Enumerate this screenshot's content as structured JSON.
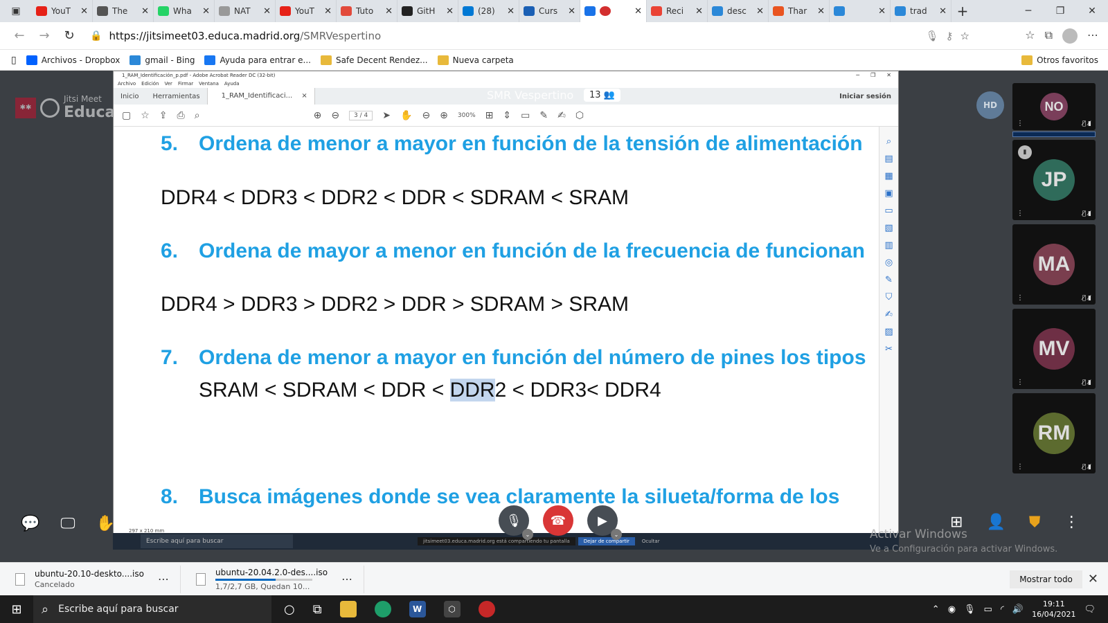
{
  "browser": {
    "tabs": [
      {
        "title": "YouT",
        "fav": "youtube-icon",
        "color": "#e62117"
      },
      {
        "title": "The",
        "fav": "medium-icon",
        "color": "#555555"
      },
      {
        "title": "Wha",
        "fav": "whatsapp-icon",
        "color": "#25d366"
      },
      {
        "title": "NAT",
        "fav": "nat-icon",
        "color": "#999999"
      },
      {
        "title": "YouT",
        "fav": "youtube-icon",
        "color": "#e62117"
      },
      {
        "title": "Tuto",
        "fav": "tuto-icon",
        "color": "#e24a3b"
      },
      {
        "title": "GitH",
        "fav": "github-icon",
        "color": "#222222"
      },
      {
        "title": "(28)",
        "fav": "mail-icon",
        "color": "#0078d4"
      },
      {
        "title": "Curs",
        "fav": "course-icon",
        "color": "#1a5fb4"
      },
      {
        "title": "",
        "fav": "jitsi-icon",
        "color": "#1a73e8",
        "active": true
      },
      {
        "title": "Reci",
        "fav": "gmail-icon",
        "color": "#ea4335"
      },
      {
        "title": "desc",
        "fav": "bing-icon",
        "color": "#2b88d8"
      },
      {
        "title": "Thar",
        "fav": "ubuntu-icon",
        "color": "#e95420"
      },
      {
        "title": "",
        "fav": "bing-icon",
        "color": "#2b88d8"
      },
      {
        "title": "trad",
        "fav": "bing-icon",
        "color": "#2b88d8"
      }
    ],
    "url_host": "https://jitsimeet03.educa.madrid.org",
    "url_path": "/SMRVespertino",
    "bookmarks": [
      {
        "label": "Archivos - Dropbox",
        "color": "#0061fe"
      },
      {
        "label": "gmail - Bing",
        "color": "#2b88d8"
      },
      {
        "label": "Ayuda para entrar e...",
        "color": "#1877f2"
      },
      {
        "label": "Safe Decent Rendez...",
        "color": "#e8b93b"
      },
      {
        "label": "Nueva carpeta",
        "color": "#e8b93b"
      }
    ],
    "other_favorites": "Otros favoritos"
  },
  "jitsi": {
    "brand_small": "Jitsi Meet",
    "brand_large": "Educa",
    "meeting_name": "SMR Vespertino",
    "participant_count": "13",
    "self_initials": "HD",
    "participants": [
      {
        "initials": "NO",
        "color": "#7a3e5a"
      },
      {
        "initials": "JP",
        "color": "#2f6b5a"
      },
      {
        "initials": "MA",
        "color": "#7a3e4e"
      },
      {
        "initials": "MV",
        "color": "#6e2f45"
      },
      {
        "initials": "RM",
        "color": "#5c6b2f"
      }
    ],
    "activate_line1": "Activar Windows",
    "activate_line2": "Ve a Configuración para activar Windows."
  },
  "acrobat": {
    "title": "1_RAM_Identificación_p.pdf - Adobe Acrobat Reader DC (32-bit)",
    "menu": [
      "Archivo",
      "Edición",
      "Ver",
      "Firmar",
      "Ventana",
      "Ayuda"
    ],
    "tabs": [
      "Inicio",
      "Herramientas",
      "1_RAM_Identificaci..."
    ],
    "signin": "Iniciar sesión",
    "page_indicator": "3 / 4",
    "zoom": "300%",
    "page_size": "297 x 210 mm"
  },
  "document": {
    "q5_num": "5.",
    "q5_text": "Ordena de menor a mayor en función de la tensión de alimentación",
    "a5": "DDR4 < DDR3 < DDR2 < DDR < SDRAM < SRAM",
    "q6_num": "6.",
    "q6_text": "Ordena de mayor a menor en función de la frecuencia de funcionan",
    "a6": "DDR4 > DDR3 > DDR2 > DDR > SDRAM > SRAM",
    "q7_num": "7.",
    "q7_text": "Ordena de menor a mayor en función del número de pines los tipos",
    "a7_pre": "SRAM < SDRAM < DDR < ",
    "a7_hl": "DDR",
    "a7_post": "2 < DDR3< DDR4",
    "q8_num": "8.",
    "q8_text": "Busca imágenes donde se vea claramente la silueta/forma de los"
  },
  "inner_taskbar": {
    "search": "Escribe aquí para buscar",
    "share_msg": "jitsimeet03.educa.madrid.org está compartiendo tu pantalla",
    "stop_share": "Dejar de compartir",
    "hide": "Ocultar"
  },
  "downloads": [
    {
      "name": "ubuntu-20.10-deskto....iso",
      "status": "Cancelado",
      "progress": null
    },
    {
      "name": "ubuntu-20.04.2.0-des....iso",
      "status": "1,7/2,7 GB, Quedan 10...",
      "progress": 0.62
    }
  ],
  "show_all": "Mostrar todo",
  "taskbar": {
    "search": "Escribe aquí para buscar",
    "time": "19:11",
    "date": "16/04/2021"
  }
}
